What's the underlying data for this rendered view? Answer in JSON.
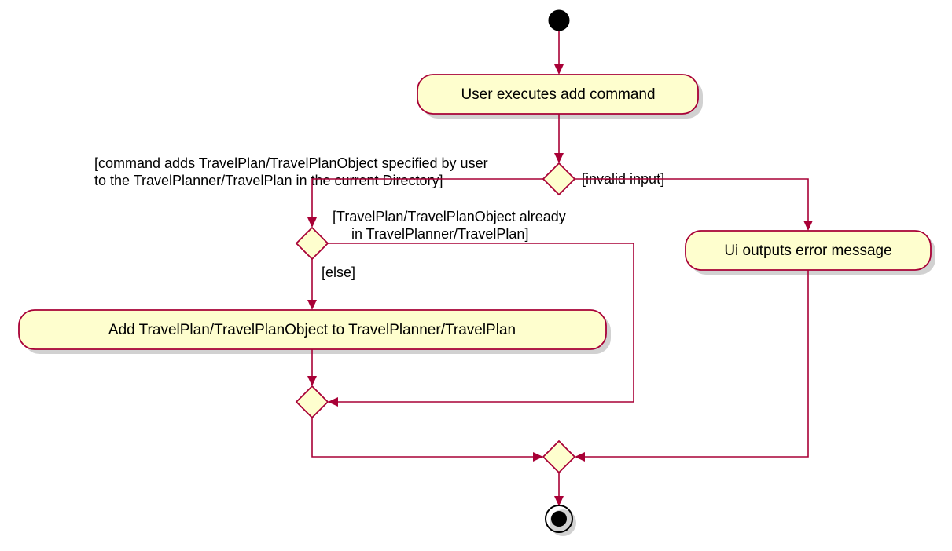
{
  "activities": {
    "a1": "User executes add command",
    "a2": "Ui outputs error message",
    "a3": "Add TravelPlan/TravelPlanObject to TravelPlanner/TravelPlan"
  },
  "guards": {
    "g_valid_l1": "[command adds TravelPlan/TravelPlanObject specified by user",
    "g_valid_l2": "to the TravelPlanner/TravelPlan in the current Directory]",
    "g_invalid": "[invalid input]",
    "g_already_l1": "[TravelPlan/TravelPlanObject already",
    "g_already_l2": "in TravelPlanner/TravelPlan]",
    "g_else": "[else]"
  },
  "chart_data": {
    "type": "uml-activity-diagram",
    "nodes": [
      {
        "id": "start",
        "kind": "initial"
      },
      {
        "id": "a1",
        "kind": "activity",
        "label": "User executes add command"
      },
      {
        "id": "d1",
        "kind": "decision"
      },
      {
        "id": "a2",
        "kind": "activity",
        "label": "Ui outputs error message"
      },
      {
        "id": "d2",
        "kind": "decision"
      },
      {
        "id": "a3",
        "kind": "activity",
        "label": "Add TravelPlan/TravelPlanObject to TravelPlanner/TravelPlan"
      },
      {
        "id": "m1",
        "kind": "merge"
      },
      {
        "id": "m2",
        "kind": "merge"
      },
      {
        "id": "end",
        "kind": "final"
      }
    ],
    "edges": [
      {
        "from": "start",
        "to": "a1"
      },
      {
        "from": "a1",
        "to": "d1"
      },
      {
        "from": "d1",
        "to": "d2",
        "guard": "command adds TravelPlan/TravelPlanObject specified by user to the TravelPlanner/TravelPlan in the current Directory"
      },
      {
        "from": "d1",
        "to": "a2",
        "guard": "invalid input"
      },
      {
        "from": "d2",
        "to": "a3",
        "guard": "else"
      },
      {
        "from": "d2",
        "to": "m1",
        "guard": "TravelPlan/TravelPlanObject already in TravelPlanner/TravelPlan"
      },
      {
        "from": "a3",
        "to": "m1"
      },
      {
        "from": "m1",
        "to": "m2"
      },
      {
        "from": "a2",
        "to": "m2"
      },
      {
        "from": "m2",
        "to": "end"
      }
    ]
  }
}
